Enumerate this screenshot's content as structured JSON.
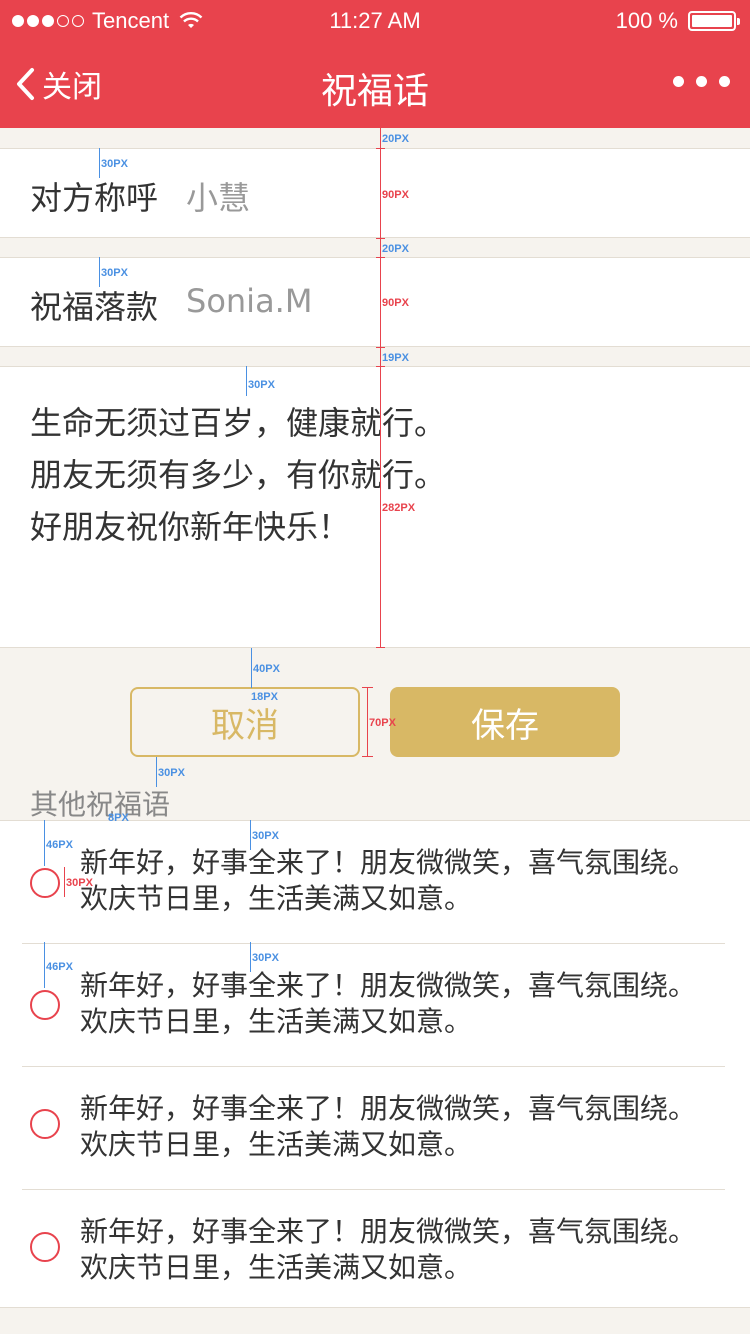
{
  "status_bar": {
    "carrier": "Tencent",
    "time": "11:27 AM",
    "battery": "100 %",
    "signal_bars_filled": 3,
    "signal_bars_total": 5
  },
  "nav": {
    "back_label": "关闭",
    "title": "祝福话"
  },
  "form": {
    "recipient_label": "对方称呼",
    "recipient_value": "小慧",
    "signature_label": "祝福落款",
    "signature_value": "Sonia.M",
    "message_lines": [
      "生命无须过百岁，健康就行。",
      "朋友无须有多少，有你就行。",
      "好朋友祝你新年快乐！"
    ]
  },
  "buttons": {
    "cancel": "取消",
    "save": "保存"
  },
  "other_section": {
    "title": "其他祝福语",
    "items": [
      {
        "line1": "新年好，好事全来了！朋友微微笑，喜气氛围绕。",
        "line2": "欢庆节日里，生活美满又如意。"
      },
      {
        "line1": "新年好，好事全来了！朋友微微笑，喜气氛围绕。",
        "line2": "欢庆节日里，生活美满又如意。"
      },
      {
        "line1": "新年好，好事全来了！朋友微微笑，喜气氛围绕。",
        "line2": "欢庆节日里，生活美满又如意。"
      },
      {
        "line1": "新年好，好事全来了！朋友微微笑，喜气氛围绕。",
        "line2": "欢庆节日里，生活美满又如意。"
      }
    ]
  },
  "annotations": {
    "a20_1": "20PX",
    "a30_1": "30PX",
    "a90_1": "90PX",
    "a20_2": "20PX",
    "a30_2": "30PX",
    "a90_2": "90PX",
    "a19": "19PX",
    "a30_3": "30PX",
    "a282": "282PX",
    "a40": "40PX",
    "a18": "18PX",
    "a70": "70PX",
    "a30_4": "30PX",
    "a8": "8PX",
    "a46_1": "46PX",
    "a30_5": "30PX",
    "a30_6": "30PX",
    "a46_2": "46PX",
    "a30_7": "30PX"
  },
  "colors": {
    "primary_red": "#e8434d",
    "gold": "#d8b865",
    "background": "#f6f3ee",
    "annotation_blue": "#4a90e2"
  }
}
